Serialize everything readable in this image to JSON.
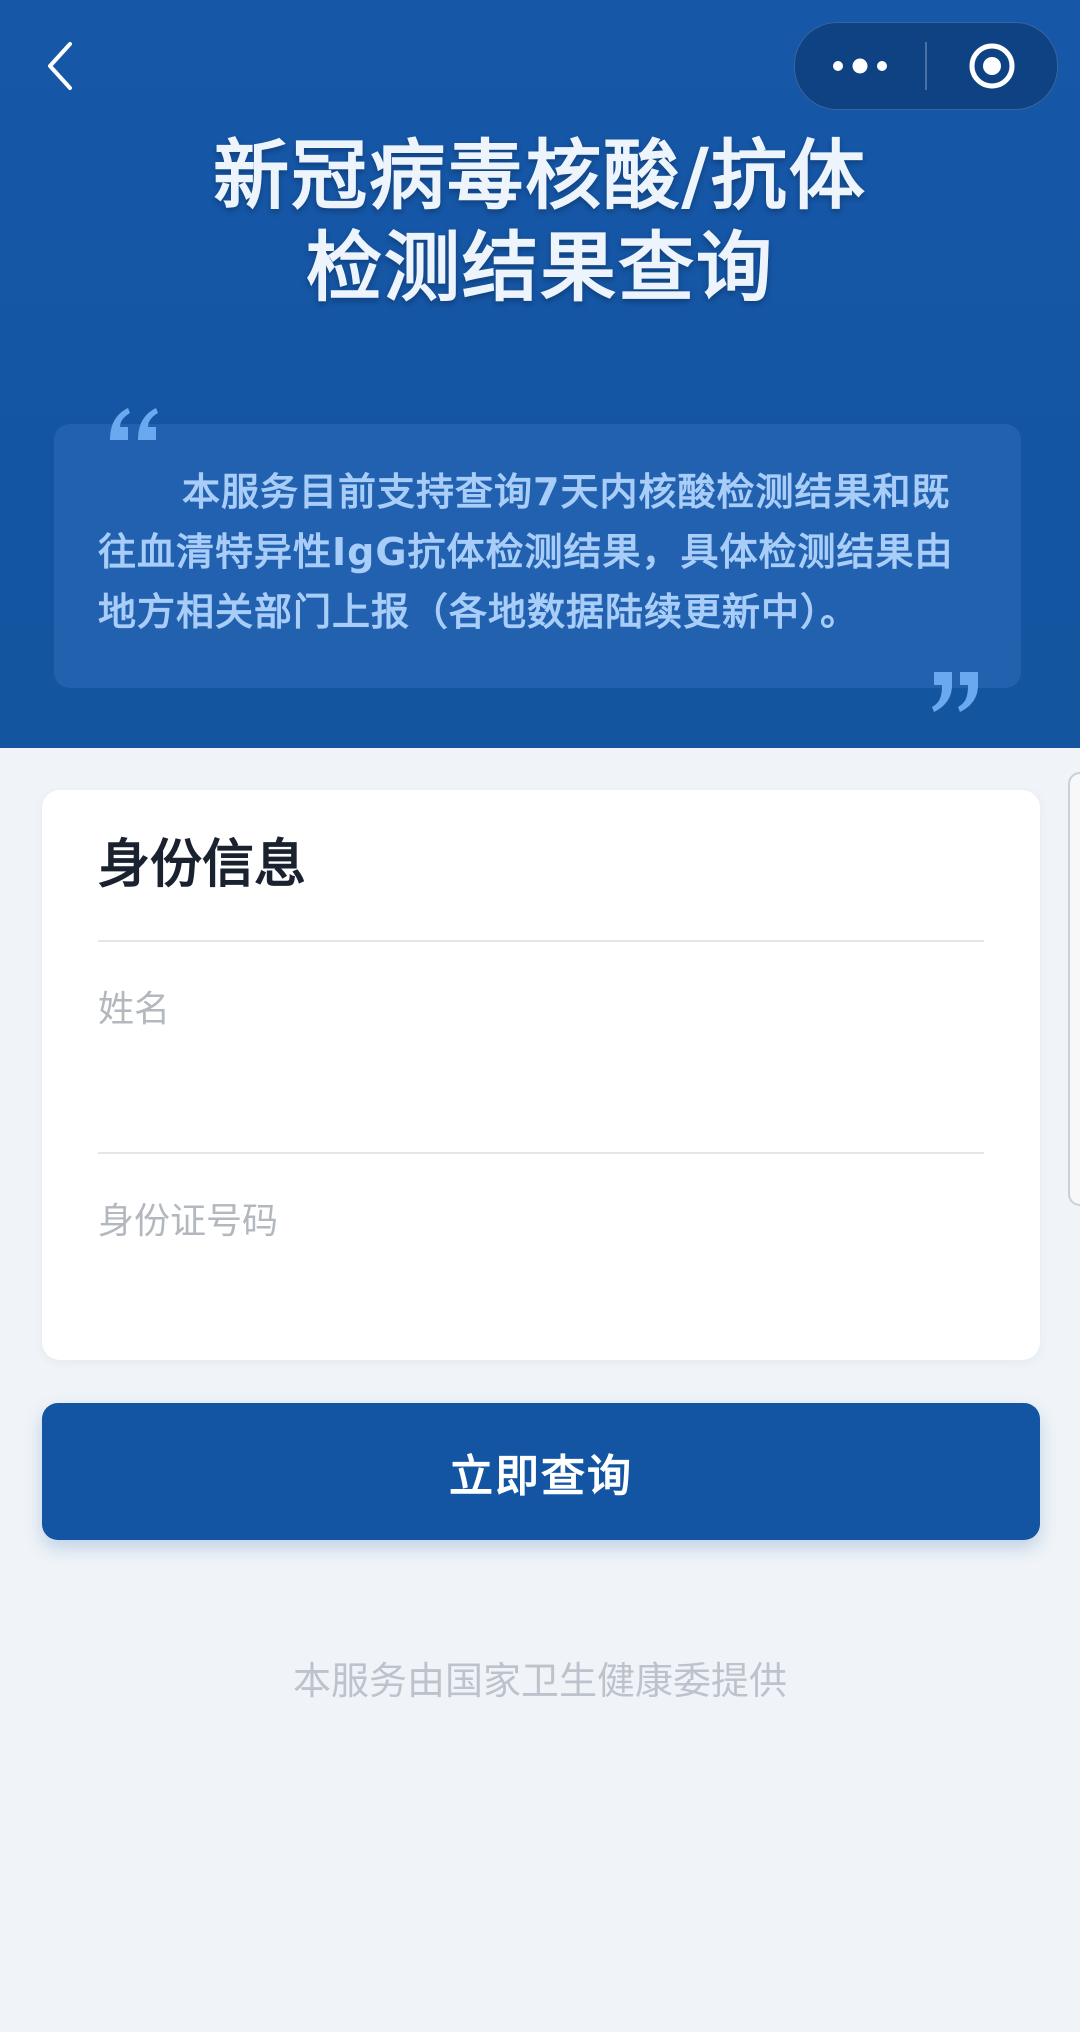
{
  "nav": {
    "back_icon": "chevron-left-icon",
    "more_icon": "more-dots-icon",
    "close_icon": "target-circle-icon"
  },
  "header": {
    "title_line1": "新冠病毒核酸/抗体",
    "title_line2": "检测结果查询",
    "notice": "本服务目前支持查询7天内核酸检测结果和既往血清特异性IgG抗体检测结果，具体检测结果由地方相关部门上报（各地数据陆续更新中）。"
  },
  "form": {
    "title": "身份信息",
    "name_placeholder": "姓名",
    "name_value": "",
    "id_placeholder": "身份证号码",
    "id_value": ""
  },
  "actions": {
    "query_label": "立即查询"
  },
  "footer": {
    "provider": "本服务由国家卫生健康委提供"
  },
  "colors": {
    "header_bg": "#1657a8",
    "primary": "#1355a2",
    "notice_text": "#a8cdf8",
    "page_bg": "#f0f4f8"
  }
}
